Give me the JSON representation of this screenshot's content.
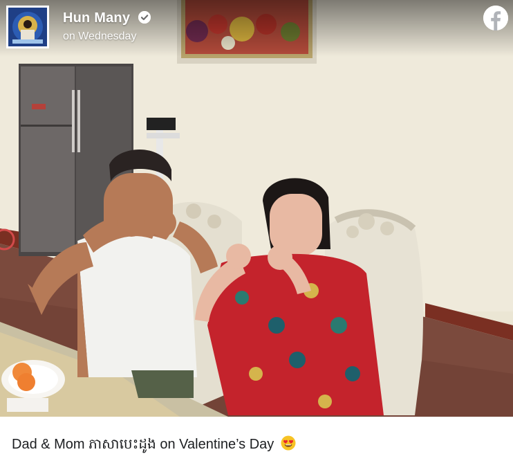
{
  "post": {
    "author": "Hun Many",
    "verified": true,
    "timestamp": "on Wednesday",
    "caption": "Dad & Mom ភាសាបេះដូង on Valentine’s Day",
    "caption_emoji": "smiling-face-with-heart-eyes"
  },
  "brand": {
    "network": "facebook",
    "color": "#1877f2"
  },
  "icons": {
    "verified": "verified-check-icon",
    "logo": "facebook-logo-icon"
  }
}
